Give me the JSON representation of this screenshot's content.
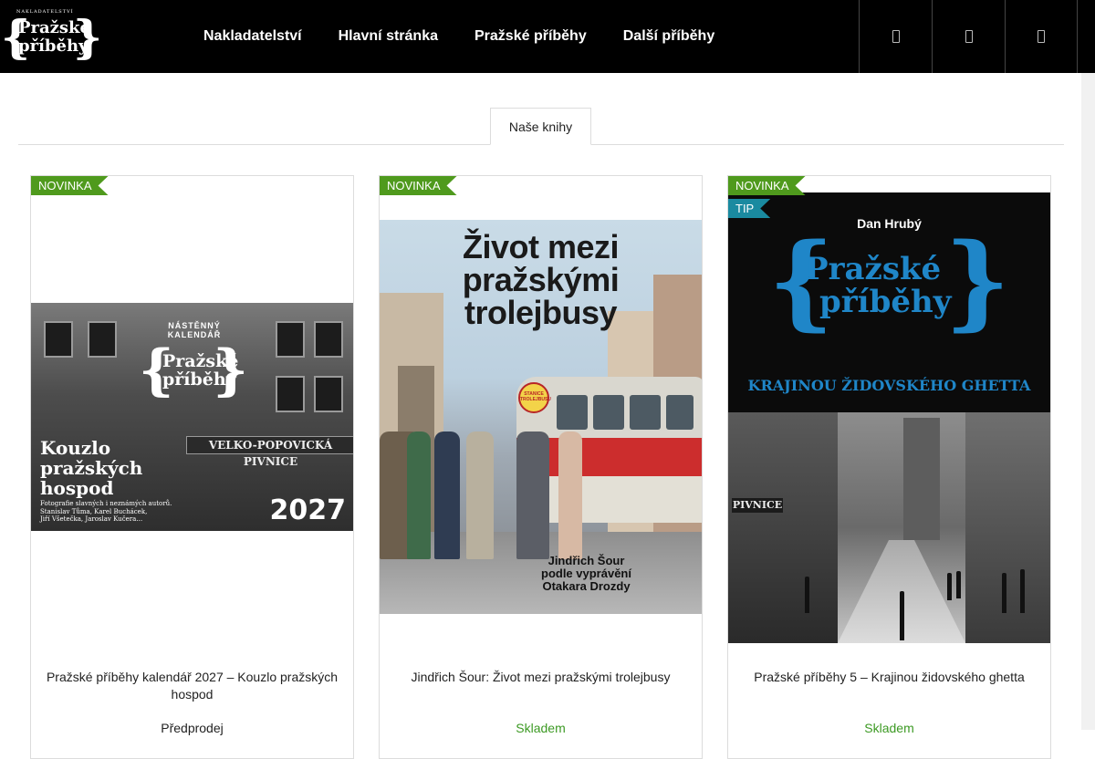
{
  "header": {
    "logo": {
      "top_text": "NAKLADATELSTVÍ",
      "line1": "Pražské",
      "line2": "příběhy",
      "brace_left": "{",
      "brace_right": "}"
    },
    "nav": [
      "Nakladatelství",
      "Hlavní stránka",
      "Pražské příběhy",
      "Další příběhy"
    ],
    "icons": [
      "search-icon",
      "user-icon",
      "cart-icon"
    ]
  },
  "tabs": {
    "active": "Naše knihy"
  },
  "products": [
    {
      "badges": [
        "NOVINKA"
      ],
      "title": "Pražské příběhy kalendář 2027 – Kouzlo pražských hospod",
      "stock": "Předprodej",
      "cover": {
        "small": "NÁSTĚNNÝ KALENDÁŘ",
        "logo_line1": "Pražské",
        "logo_line2": "příběhy",
        "sign": "VELKO-POPOVICKÁ PIVNICE",
        "title_line1": "Kouzlo",
        "title_line2": "pražských",
        "title_line3": "hospod",
        "sub_line1": "Fotografie slavných i neznámých autorů.",
        "sub_line2": "Stanislav Tůma, Karel Buchácek,",
        "sub_line3": "Jiří Všetečka, Jaroslav Kučera…",
        "year": "2027"
      }
    },
    {
      "badges": [
        "NOVINKA"
      ],
      "title": "Jindřich Šour: Život mezi pražskými trolejbusy",
      "stock": "Skladem",
      "cover": {
        "title_line1": "Život mezi",
        "title_line2": "pražskými",
        "title_line3": "trolejbusy",
        "stop_sign": "STANICE TROLEJBUSU",
        "author_line1": "Jindřich Šour",
        "author_line2": "podle vyprávění",
        "author_line3": "Otakara Drozdy"
      }
    },
    {
      "badges": [
        "NOVINKA",
        "TIP"
      ],
      "title": "Pražské příběhy 5 – Krajinou židovského ghetta",
      "stock": "Skladem",
      "cover": {
        "author": "Dan Hrubý",
        "logo_line1": "Pražské",
        "logo_line2": "příběhy",
        "subtitle": "KRAJINOU ŽIDOVSKÉHO GHETTA",
        "sign": "PIVNICE"
      }
    }
  ],
  "colors": {
    "header_bg": "#000000",
    "badge_new": "#4f9a1d",
    "badge_tip": "#1a8aa0",
    "stock_ok": "#3d9a24",
    "cover_blue": "#1f86c8"
  }
}
